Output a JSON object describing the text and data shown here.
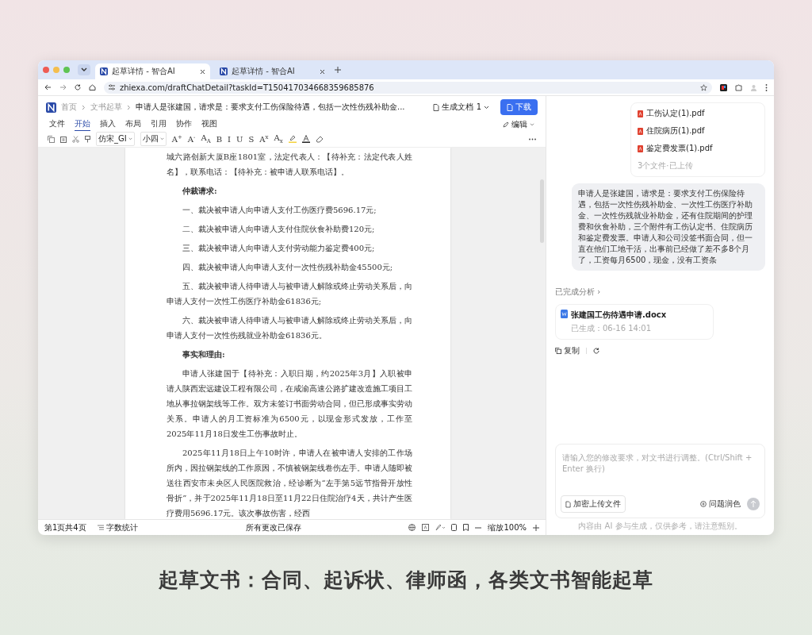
{
  "browser": {
    "tabs": [
      {
        "title": "起草详情 - 智合AI",
        "selected": true
      },
      {
        "title": "起草详情 - 智合AI",
        "selected": false
      }
    ],
    "url": "zhiexa.com/draftChatDetail?taskId=T150417034668359685876"
  },
  "editor": {
    "breadcrumb": [
      "首页",
      "文书起草"
    ],
    "doc_title": "申请人是张建国，请求是：要求支付工伤保险待遇，包括一次性伤残补助金...",
    "generated_doc": "生成文档 1",
    "download": "下载",
    "menu": [
      {
        "label": "文件",
        "selected": false
      },
      {
        "label": "开始",
        "selected": true
      },
      {
        "label": "插入",
        "selected": false
      },
      {
        "label": "布局",
        "selected": false
      },
      {
        "label": "引用",
        "selected": false
      },
      {
        "label": "协作",
        "selected": false
      },
      {
        "label": "视图",
        "selected": false
      }
    ],
    "edit_mode": "编辑",
    "font": "仿宋_GI",
    "size": "小四",
    "format_buttons": [
      "A$^{+}$",
      "A$^{-}$",
      "A$_{A}$",
      "B",
      "I",
      "U",
      "S",
      "A$^{x}$",
      "A$_{x}$"
    ],
    "document": [
      {
        "kind": "cont",
        "text": "城六路创新大厦B座1801室，法定代表人：【待补充：法定代表人姓名】，联系电话：【待补充：被申请人联系电话】。"
      },
      {
        "kind": "heading",
        "text": "仲裁请求:"
      },
      {
        "kind": "item",
        "text": "一、裁决被申请人向申请人支付工伤医疗费5696.17元;"
      },
      {
        "kind": "item",
        "text": "二、裁决被申请人向申请人支付住院伙食补助费120元;"
      },
      {
        "kind": "item",
        "text": "三、裁决被申请人向申请人支付劳动能力鉴定费400元;"
      },
      {
        "kind": "item",
        "text": "四、裁决被申请人向申请人支付一次性伤残补助金45500元;"
      },
      {
        "kind": "item",
        "text": "五、裁决被申请人待申请人与被申请人解除或终止劳动关系后，向申请人支付一次性工伤医疗补助金61836元;"
      },
      {
        "kind": "item",
        "text": "六、裁决被申请人待申请人与被申请人解除或终止劳动关系后，向申请人支付一次性伤残就业补助金61836元。"
      },
      {
        "kind": "heading",
        "text": "事实和理由:"
      },
      {
        "kind": "item",
        "text": "申请人张建国于【待补充：入职日期，约2025年3月】入职被申请人陕西宏远建设工程有限公司，在咸渝高速公路扩建改造施工项目工地从事拉钢架线等工作。双方未签订书面劳动合同，但已形成事实劳动关系。申请人的月工资标准为6500元，以现金形式发放，工作至2025年11月18日发生工伤事故时止。"
      },
      {
        "kind": "item",
        "text": "2025年11月18日上午10时许，申请人在被申请人安排的工作场所内，因拉钢架线的工作原因，不慎被钢架线卷伤左手。申请人随即被送往西安市未央区人民医院救治，经诊断为“左手第5远节指骨开放性骨折”，并于2025年11月18日至11月22日住院治疗4天，共计产生医疗费用5696.17元。该次事故伤害，经西"
      }
    ],
    "status": {
      "page": "第1页共4页",
      "word_count": "字数统计",
      "saved": "所有更改已保存",
      "zoom": "缩放100%"
    }
  },
  "chat": {
    "files": [
      "工伤认定(1).pdf",
      "住院病历(1).pdf",
      "鉴定费发票(1).pdf"
    ],
    "files_note": "3个文件·已上传",
    "message": "申请人是张建国，请求是：要求支付工伤保险待遇，包括一次性伤残补助金、一次性工伤医疗补助金、一次性伤残就业补助金，还有住院期间的护理费和伙食补助，三个附件有工伤认定书、住院病历和鉴定费发票。申请人和公司没签书面合同，但一直在他们工地干活，出事前已经做了差不多8个月了，工资每月6500，现金，没有工资条",
    "analysis": "已完成分析 ›",
    "result_file": "张建国工伤待遇申请.docx",
    "result_time": "已生成：06-16 14:01",
    "copy": "复制",
    "placeholder": "请输入您的修改要求，对文书进行调整。(Ctrl/Shift + Enter 换行)",
    "upload": "加密上传文件",
    "polish": "问题润色",
    "disclaimer": "内容由 AI 参与生成，仅供参考，请注意甄别。"
  },
  "caption": "起草文书：合同、起诉状、律师函，各类文书智能起草"
}
